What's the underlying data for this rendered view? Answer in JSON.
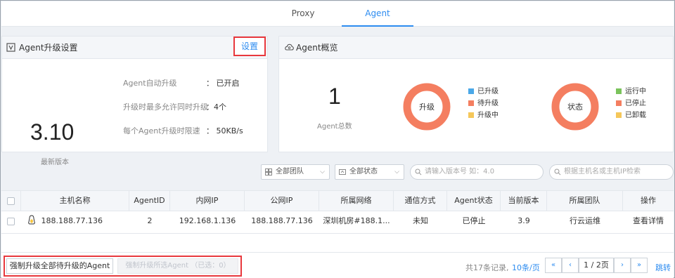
{
  "tabs": [
    {
      "label": "Proxy",
      "active": false
    },
    {
      "label": "Agent",
      "active": true
    }
  ],
  "upgrade_card": {
    "title": "Agent升级设置",
    "settings_button": "设置",
    "version": "3.10",
    "version_label": "最新版本",
    "settings": [
      {
        "label": "Agent自动升级",
        "value": "： 已开启"
      },
      {
        "label": "升级时最多允许同时升级",
        "value": "：4个"
      },
      {
        "label": "每个Agent升级时限速",
        "value": "： 50KB/s"
      }
    ]
  },
  "overview_card": {
    "title": "Agent概览",
    "total": "1",
    "total_label": "Agent总数",
    "upgrade_donut": {
      "center_label": "升级",
      "legend": [
        {
          "label": "已升级",
          "color": "#4aa8e8"
        },
        {
          "label": "待升级",
          "color": "#f47e60"
        },
        {
          "label": "升级中",
          "color": "#f5c75a"
        }
      ]
    },
    "status_donut": {
      "center_label": "状态",
      "legend": [
        {
          "label": "运行中",
          "color": "#7ac35b"
        },
        {
          "label": "已停止",
          "color": "#f47e60"
        },
        {
          "label": "已卸载",
          "color": "#f5c75a"
        }
      ]
    },
    "donut_color": "#f47e60"
  },
  "filters": {
    "team": "全部团队",
    "status": "全部状态",
    "version_placeholder": "请输入版本号 如：4.0",
    "host_placeholder": "根据主机名或主机IP检索"
  },
  "table": {
    "columns": [
      "主机名称",
      "AgentID",
      "内网IP",
      "公网IP",
      "所属网络",
      "通信方式",
      "Agent状态",
      "当前版本",
      "所属团队",
      "操作"
    ],
    "rows": [
      {
        "host": "188.188.77.136",
        "agent_id": "2",
        "private_ip": "192.168.1.136",
        "public_ip": "188.188.77.136",
        "network": "深圳机房#188.1...",
        "comm": "未知",
        "status": "已停止",
        "version": "3.9",
        "team": "行云运维",
        "action": "查看详情"
      }
    ]
  },
  "footer": {
    "bulk_all": "强制升级全部待升级的Agent",
    "bulk_selected": "强制升级所选Agent （已选：0）",
    "total_records": "共17条记录,",
    "per_page": "10条/页",
    "first": "«",
    "prev": "‹",
    "page_info": "1 / 2页",
    "next": "›",
    "last": "»",
    "jump": "跳转"
  }
}
